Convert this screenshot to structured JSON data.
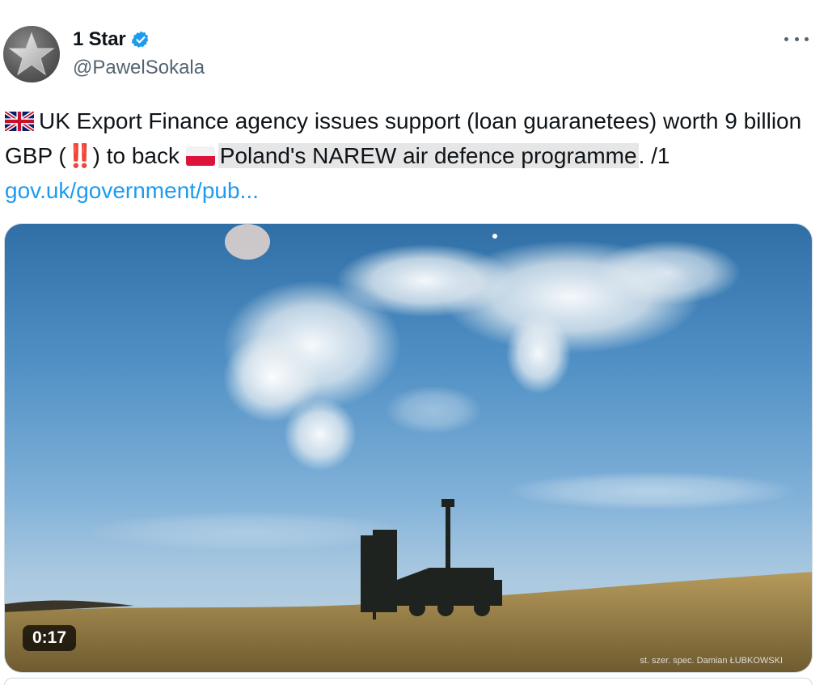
{
  "author": {
    "display_name": "1 Star",
    "handle": "@PawelSokala",
    "verified_icon": "verified-badge-icon",
    "avatar_icon": "star-icon"
  },
  "tweet": {
    "text_part1": "UK Export Finance agency issues support (loan guaranetees) worth 9 billion GBP (",
    "emphasis": "‼️",
    "text_part2": ") to back",
    "highlighted_text": "Poland's NAREW air defence programme",
    "text_part3": ". /1",
    "link": "gov.uk/government/pub..."
  },
  "media": {
    "type": "video",
    "duration": "0:17",
    "credit": "st. szer. spec. Damian ŁUBKOWSKI"
  },
  "colors": {
    "link": "#1d9bf0",
    "verified": "#1d9bf0",
    "text": "#0f1419",
    "secondary": "#536471"
  }
}
